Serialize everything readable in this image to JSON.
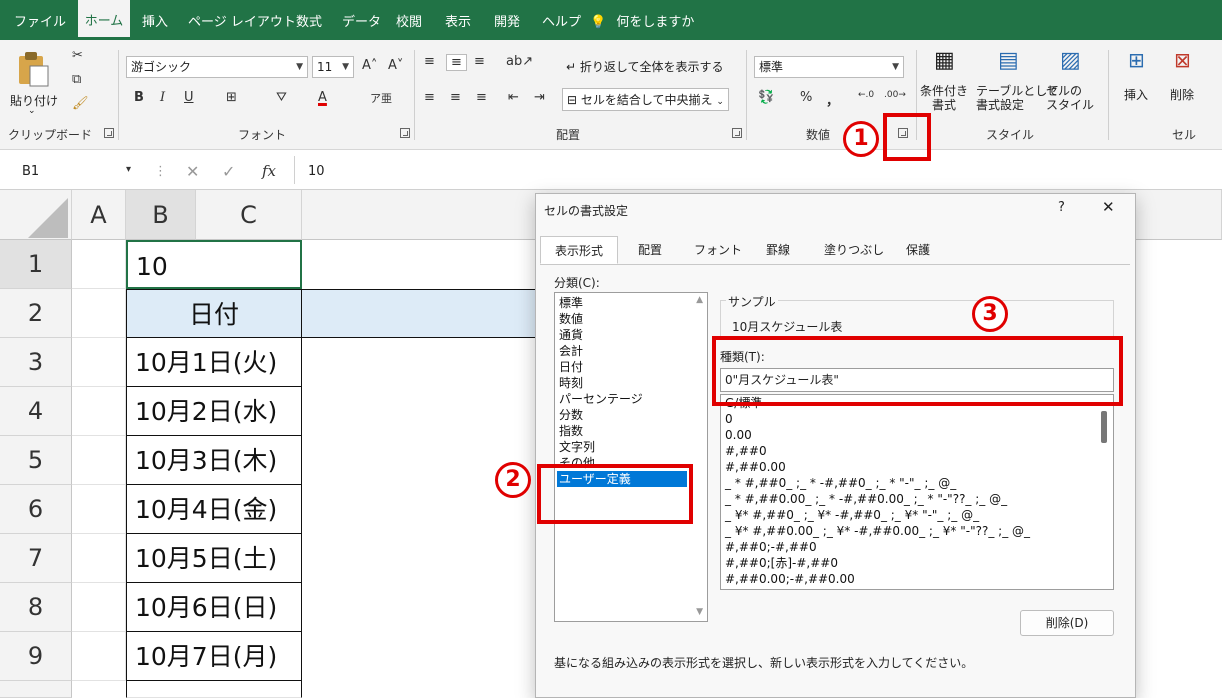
{
  "ribbon_tabs": [
    "ファイル",
    "ホーム",
    "挿入",
    "ページ レイアウト",
    "数式",
    "データ",
    "校閲",
    "表示",
    "開発",
    "ヘルプ",
    "何をしますか"
  ],
  "active_tab": "ホーム",
  "clipboard": {
    "paste_label": "貼り付け",
    "group_label": "クリップボード"
  },
  "font": {
    "family": "游ゴシック",
    "size": "11",
    "group_label": "フォント",
    "bold": "B",
    "italic": "I",
    "underline": "U",
    "color_letter": "A"
  },
  "alignment": {
    "wrap_label": "折り返して全体を表示する",
    "merge_label": "セルを結合して中央揃え",
    "group_label": "配置"
  },
  "number": {
    "format": "標準",
    "percent": "%",
    "comma": "，",
    "group_label": "数値"
  },
  "styles": {
    "conditional": "条件付き\n書式",
    "table": "テーブルとして\n書式設定",
    "cell": "セルの\nスタイル",
    "group_label": "スタイル"
  },
  "cells": {
    "insert": "挿入",
    "delete": "削除",
    "group_label": "セル"
  },
  "formula_bar": {
    "name_box": "B1",
    "fx": "fx",
    "value": "10"
  },
  "sheet": {
    "columns": [
      "A",
      "B",
      "C"
    ],
    "rows": [
      {
        "num": "1",
        "b": "10"
      },
      {
        "num": "2",
        "b": "日付"
      },
      {
        "num": "3",
        "b": "10月1日(火)"
      },
      {
        "num": "4",
        "b": "10月2日(水)"
      },
      {
        "num": "5",
        "b": "10月3日(木)"
      },
      {
        "num": "6",
        "b": "10月4日(金)"
      },
      {
        "num": "7",
        "b": "10月5日(土)"
      },
      {
        "num": "8",
        "b": "10月6日(日)"
      },
      {
        "num": "9",
        "b": "10月7日(月)"
      }
    ],
    "header_fill": "#ddebf7"
  },
  "dialog": {
    "title": "セルの書式設定",
    "help": "?",
    "close": "✕",
    "tabs": [
      "表示形式",
      "配置",
      "フォント",
      "罫線",
      "塗りつぶし",
      "保護"
    ],
    "category_label": "分類(C):",
    "categories": [
      "標準",
      "数値",
      "通貨",
      "会計",
      "日付",
      "時刻",
      "パーセンテージ",
      "分数",
      "指数",
      "文字列",
      "その他",
      "ユーザー定義"
    ],
    "selected_category": "ユーザー定義",
    "sample_label": "サンプル",
    "sample_value": "10月スケジュール表",
    "type_label": "種類(T):",
    "type_value": "0\"月スケジュール表\"",
    "formats": [
      "G/標準",
      "0",
      "0.00",
      "#,##0",
      "#,##0.00",
      "_ * #,##0_ ;_ * -#,##0_ ;_ * \"-\"_ ;_ @_",
      "_ * #,##0.00_ ;_ * -#,##0.00_ ;_ * \"-\"??_ ;_ @_",
      "_ ¥* #,##0_ ;_ ¥* -#,##0_ ;_ ¥* \"-\"_ ;_ @_",
      "_ ¥* #,##0.00_ ;_ ¥* -#,##0.00_ ;_ ¥* \"-\"??_ ;_ @_",
      "#,##0;-#,##0",
      "#,##0;[赤]-#,##0",
      "#,##0.00;-#,##0.00"
    ],
    "delete_button": "削除(D)",
    "description": "基になる組み込みの表示形式を選択し、新しい表示形式を入力してください。"
  },
  "annotations": {
    "badge1": "1",
    "badge2": "2",
    "badge3": "3"
  },
  "colors": {
    "excel_green": "#217346",
    "highlight_red": "#e00000",
    "selection_blue": "#0078d7"
  }
}
